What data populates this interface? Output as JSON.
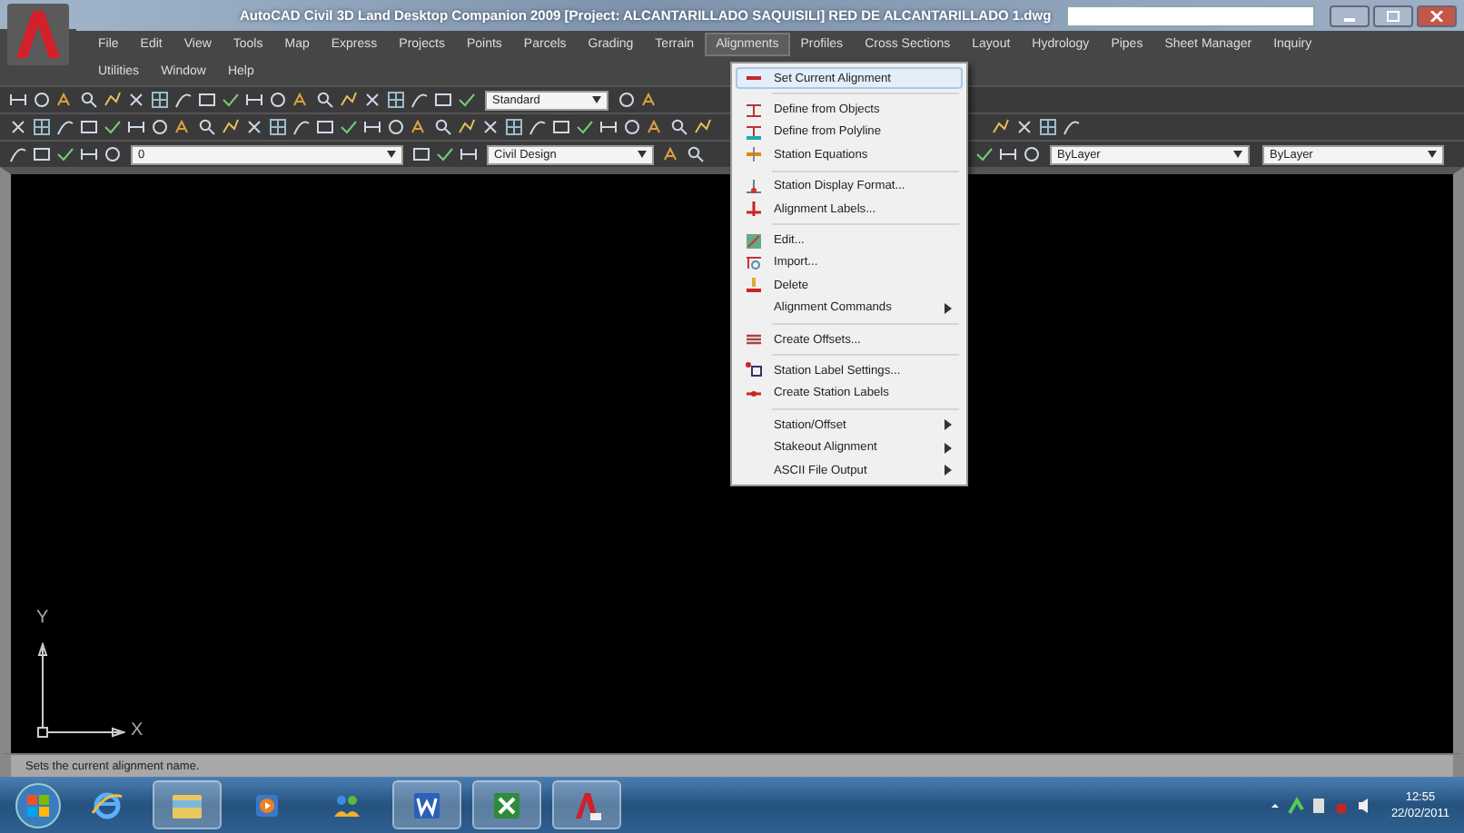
{
  "window": {
    "title": "AutoCAD Civil 3D Land Desktop Companion 2009 [Project: ALCANTARILLADO SAQUISILI] RED DE ALCANTARILLADO 1.dwg"
  },
  "menus": [
    {
      "label": "File",
      "selected": false
    },
    {
      "label": "Edit",
      "selected": false
    },
    {
      "label": "View",
      "selected": false
    },
    {
      "label": "Tools",
      "selected": false
    },
    {
      "label": "Map",
      "selected": false
    },
    {
      "label": "Express",
      "selected": false
    },
    {
      "label": "Projects",
      "selected": false
    },
    {
      "label": "Points",
      "selected": false
    },
    {
      "label": "Parcels",
      "selected": false
    },
    {
      "label": "Grading",
      "selected": false
    },
    {
      "label": "Terrain",
      "selected": false
    },
    {
      "label": "Alignments",
      "selected": true
    },
    {
      "label": "Profiles",
      "selected": false
    },
    {
      "label": "Cross Sections",
      "selected": false
    },
    {
      "label": "Layout",
      "selected": false
    },
    {
      "label": "Hydrology",
      "selected": false
    },
    {
      "label": "Pipes",
      "selected": false
    },
    {
      "label": "Sheet Manager",
      "selected": false
    },
    {
      "label": "Inquiry",
      "selected": false
    }
  ],
  "menus_second_line": [
    {
      "label": "Utilities",
      "selected": false
    },
    {
      "label": "Window",
      "selected": false
    },
    {
      "label": "Help",
      "selected": false
    }
  ],
  "toolbars": {
    "text_style": "Standard",
    "layer": "0",
    "workspace": "Civil Design",
    "color_dropdown": "ByLayer",
    "linetype": "ByLayer"
  },
  "alignments_menu": [
    {
      "kind": "item",
      "label": "Set Current Alignment",
      "selected": true
    },
    {
      "kind": "separator"
    },
    {
      "kind": "item",
      "label": "Define from Objects",
      "selected": false
    },
    {
      "kind": "item",
      "label": "Define from Polyline",
      "selected": false
    },
    {
      "kind": "item",
      "label": "Station Equations",
      "selected": false
    },
    {
      "kind": "separator"
    },
    {
      "kind": "item",
      "label": "Station Display Format...",
      "selected": false
    },
    {
      "kind": "item",
      "label": "Alignment Labels...",
      "selected": false
    },
    {
      "kind": "separator"
    },
    {
      "kind": "item",
      "label": "Edit...",
      "selected": false
    },
    {
      "kind": "item",
      "label": "Import...",
      "selected": false
    },
    {
      "kind": "item",
      "label": "Delete",
      "selected": false
    },
    {
      "kind": "submenu",
      "label": "Alignment Commands",
      "selected": false
    },
    {
      "kind": "separator"
    },
    {
      "kind": "item",
      "label": "Create Offsets...",
      "selected": false
    },
    {
      "kind": "separator"
    },
    {
      "kind": "item",
      "label": "Station Label Settings...",
      "selected": false
    },
    {
      "kind": "item",
      "label": "Create Station Labels",
      "selected": false
    },
    {
      "kind": "separator"
    },
    {
      "kind": "submenu",
      "label": "Station/Offset",
      "selected": false
    },
    {
      "kind": "submenu",
      "label": "Stakeout Alignment",
      "selected": false
    },
    {
      "kind": "submenu",
      "label": "ASCII File Output",
      "selected": false
    }
  ],
  "ucs": {
    "y_label": "Y",
    "x_label": "X"
  },
  "status_bar": "Sets the current alignment name.",
  "taskbar": {
    "apps": [
      {
        "kind": "ie",
        "active": false
      },
      {
        "kind": "folder",
        "active": true
      },
      {
        "kind": "media",
        "active": false
      },
      {
        "kind": "people",
        "active": false
      },
      {
        "kind": "word",
        "active": true
      },
      {
        "kind": "excel",
        "active": true
      },
      {
        "kind": "autocad",
        "active": true
      }
    ],
    "time": "12:55",
    "date": "22/02/2011"
  }
}
